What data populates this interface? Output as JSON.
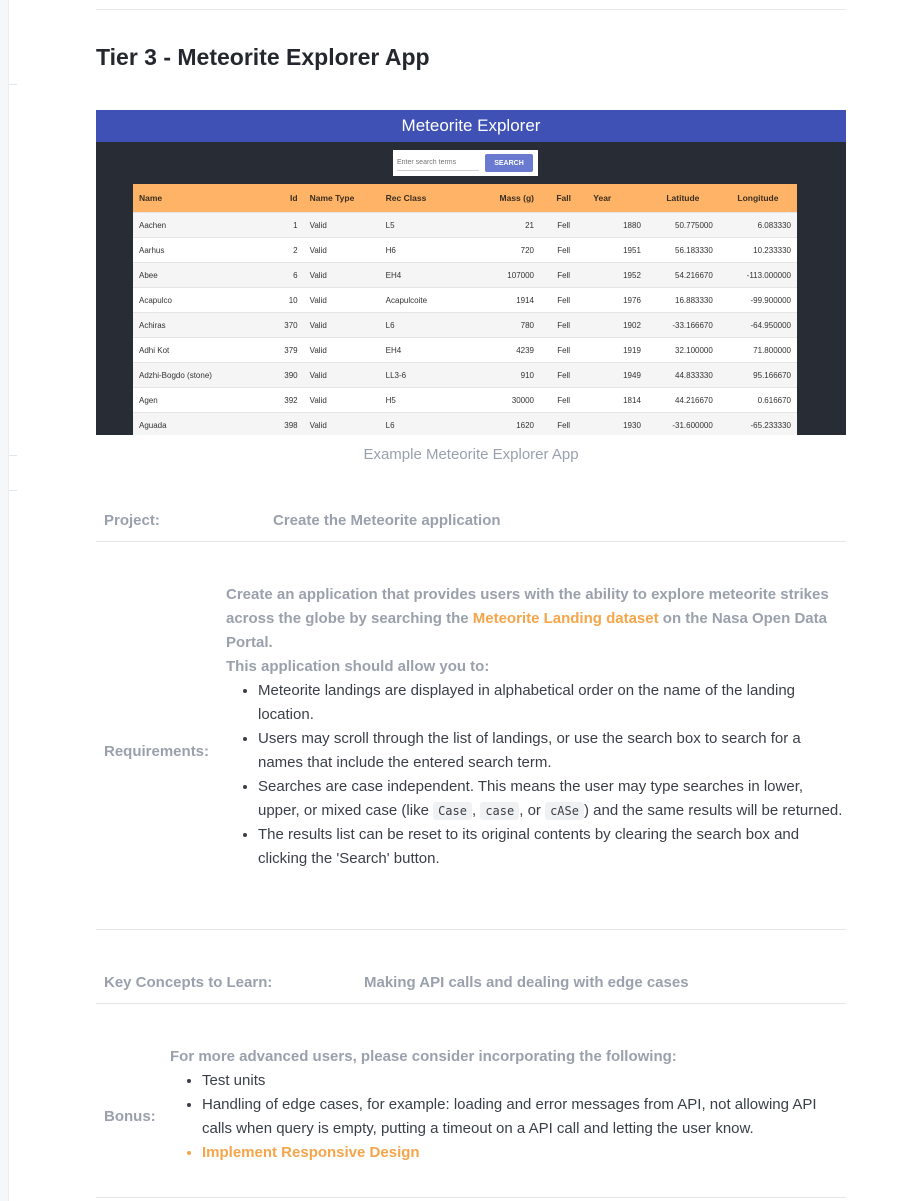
{
  "page": {
    "title": "Tier 3 - Meteorite Explorer App",
    "caption": "Example Meteorite Explorer App"
  },
  "screenshot": {
    "app_title": "Meteorite Explorer",
    "search_placeholder": "Enter search terms",
    "search_button": "SEARCH",
    "columns": [
      "Name",
      "Id",
      "Name Type",
      "Rec Class",
      "Mass (g)",
      "Fall",
      "Year",
      "Latitude",
      "Longitude"
    ],
    "rows": [
      [
        "Aachen",
        "1",
        "Valid",
        "L5",
        "21",
        "Fell",
        "1880",
        "50.775000",
        "6.083330"
      ],
      [
        "Aarhus",
        "2",
        "Valid",
        "H6",
        "720",
        "Fell",
        "1951",
        "56.183330",
        "10.233330"
      ],
      [
        "Abee",
        "6",
        "Valid",
        "EH4",
        "107000",
        "Fell",
        "1952",
        "54.216670",
        "-113.000000"
      ],
      [
        "Acapulco",
        "10",
        "Valid",
        "Acapulcoite",
        "1914",
        "Fell",
        "1976",
        "16.883330",
        "-99.900000"
      ],
      [
        "Achiras",
        "370",
        "Valid",
        "L6",
        "780",
        "Fell",
        "1902",
        "-33.166670",
        "-64.950000"
      ],
      [
        "Adhi Kot",
        "379",
        "Valid",
        "EH4",
        "4239",
        "Fell",
        "1919",
        "32.100000",
        "71.800000"
      ],
      [
        "Adzhi-Bogdo (stone)",
        "390",
        "Valid",
        "LL3-6",
        "910",
        "Fell",
        "1949",
        "44.833330",
        "95.166670"
      ],
      [
        "Agen",
        "392",
        "Valid",
        "H5",
        "30000",
        "Fell",
        "1814",
        "44.216670",
        "0.616670"
      ],
      [
        "Aguada",
        "398",
        "Valid",
        "L6",
        "1620",
        "Fell",
        "1930",
        "-31.600000",
        "-65.233330"
      ]
    ]
  },
  "project": {
    "label": "Project:",
    "value": "Create the Meteorite application"
  },
  "requirements": {
    "label": "Requirements:",
    "intro_before_link": "Create an application that provides users with the ability to explore meteorite strikes across the globe by searching the ",
    "link_text": "Meteorite Landing dataset",
    "intro_after_link": " on the Nasa Open Data Portal.",
    "allow_text": "This application should allow you to:",
    "items": [
      "Meteorite landings are displayed in alphabetical order on the name of the landing location.",
      "Users may scroll through the list of landings, or use the search box to search for a names that include the entered search term.",
      "",
      "The results list can be reset to its original contents by clearing the search box and clicking the 'Search' button."
    ],
    "case_item": {
      "before": "Searches are case independent. This means the user may type searches in lower, upper, or mixed case (like ",
      "code1": "Case",
      "sep1": ", ",
      "code2": "case",
      "sep2": ", or ",
      "code3": "cASe",
      "after": ") and the same results will be returned."
    }
  },
  "key_concepts": {
    "label": "Key Concepts to Learn:",
    "value": "Making API calls and dealing with edge cases"
  },
  "bonus": {
    "label": "Bonus:",
    "intro": "For more advanced users, please consider incorporating the following:",
    "items": [
      "Test units",
      "Handling of edge cases, for example: loading and error messages from API, not allowing API calls when query is empty, putting a timeout on a API call and letting the user know."
    ],
    "link_item": "Implement Responsive Design"
  },
  "colors": {
    "header_blue": "#3f51b5",
    "table_header_orange": "#ffb366",
    "link_orange": "#f5a54a",
    "muted_gray": "#9aa1ad"
  }
}
